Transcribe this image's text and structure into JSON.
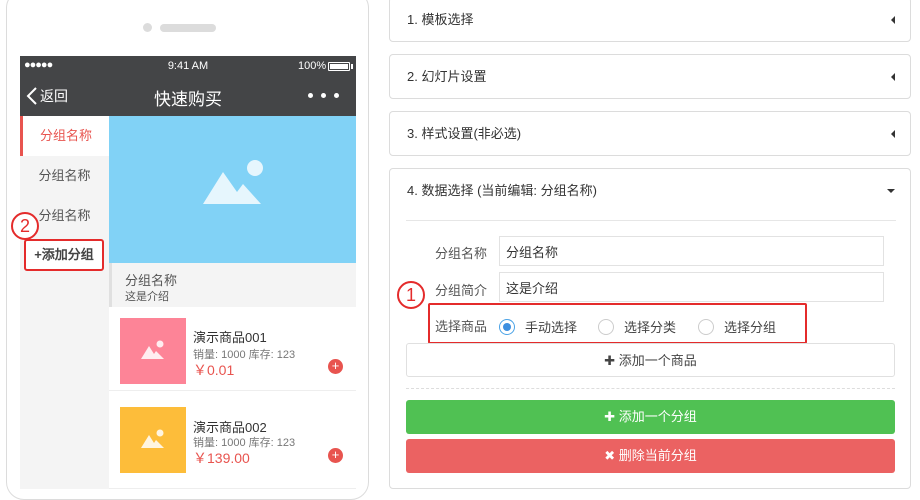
{
  "phone": {
    "status": {
      "signal": "●●●●● ",
      "time": "9:41 AM",
      "battery": "100%"
    },
    "nav": {
      "back": "返回",
      "title": "快速购买"
    },
    "sidebar": {
      "items": [
        {
          "label": "分组名称"
        },
        {
          "label": "分组名称"
        },
        {
          "label": "分组名称"
        }
      ],
      "add_label": "+添加分组"
    },
    "group": {
      "name": "分组名称",
      "desc": "这是介绍"
    },
    "products": [
      {
        "name": "演示商品001",
        "meta": "销量: 1000 库存: 123",
        "price": "￥0.01",
        "color": "#fd8497"
      },
      {
        "name": "演示商品002",
        "meta": "销量: 1000 库存: 123",
        "price": "￥139.00",
        "color": "#fdbd3a"
      }
    ]
  },
  "annotations": {
    "one": "1",
    "two": "2"
  },
  "panels": {
    "p1": "1. 模板选择",
    "p2": "2. 幻灯片设置",
    "p3": "3. 样式设置(非必选)",
    "p4": "4. 数据选择 (当前编辑: 分组名称)"
  },
  "form": {
    "name_label": "分组名称",
    "name_value": "分组名称",
    "intro_label": "分组简介",
    "intro_value": "这是介绍",
    "select_label": "选择商品",
    "options": [
      "手动选择",
      "选择分类",
      "选择分组"
    ],
    "selected": 0
  },
  "buttons": {
    "add_product": "添加一个商品",
    "add_group": "添加一个分组",
    "delete_group": "删除当前分组"
  },
  "colors": {
    "accent": "#e8544f",
    "green": "#50c153",
    "red": "#eb6262",
    "banner": "#81d2f6"
  }
}
